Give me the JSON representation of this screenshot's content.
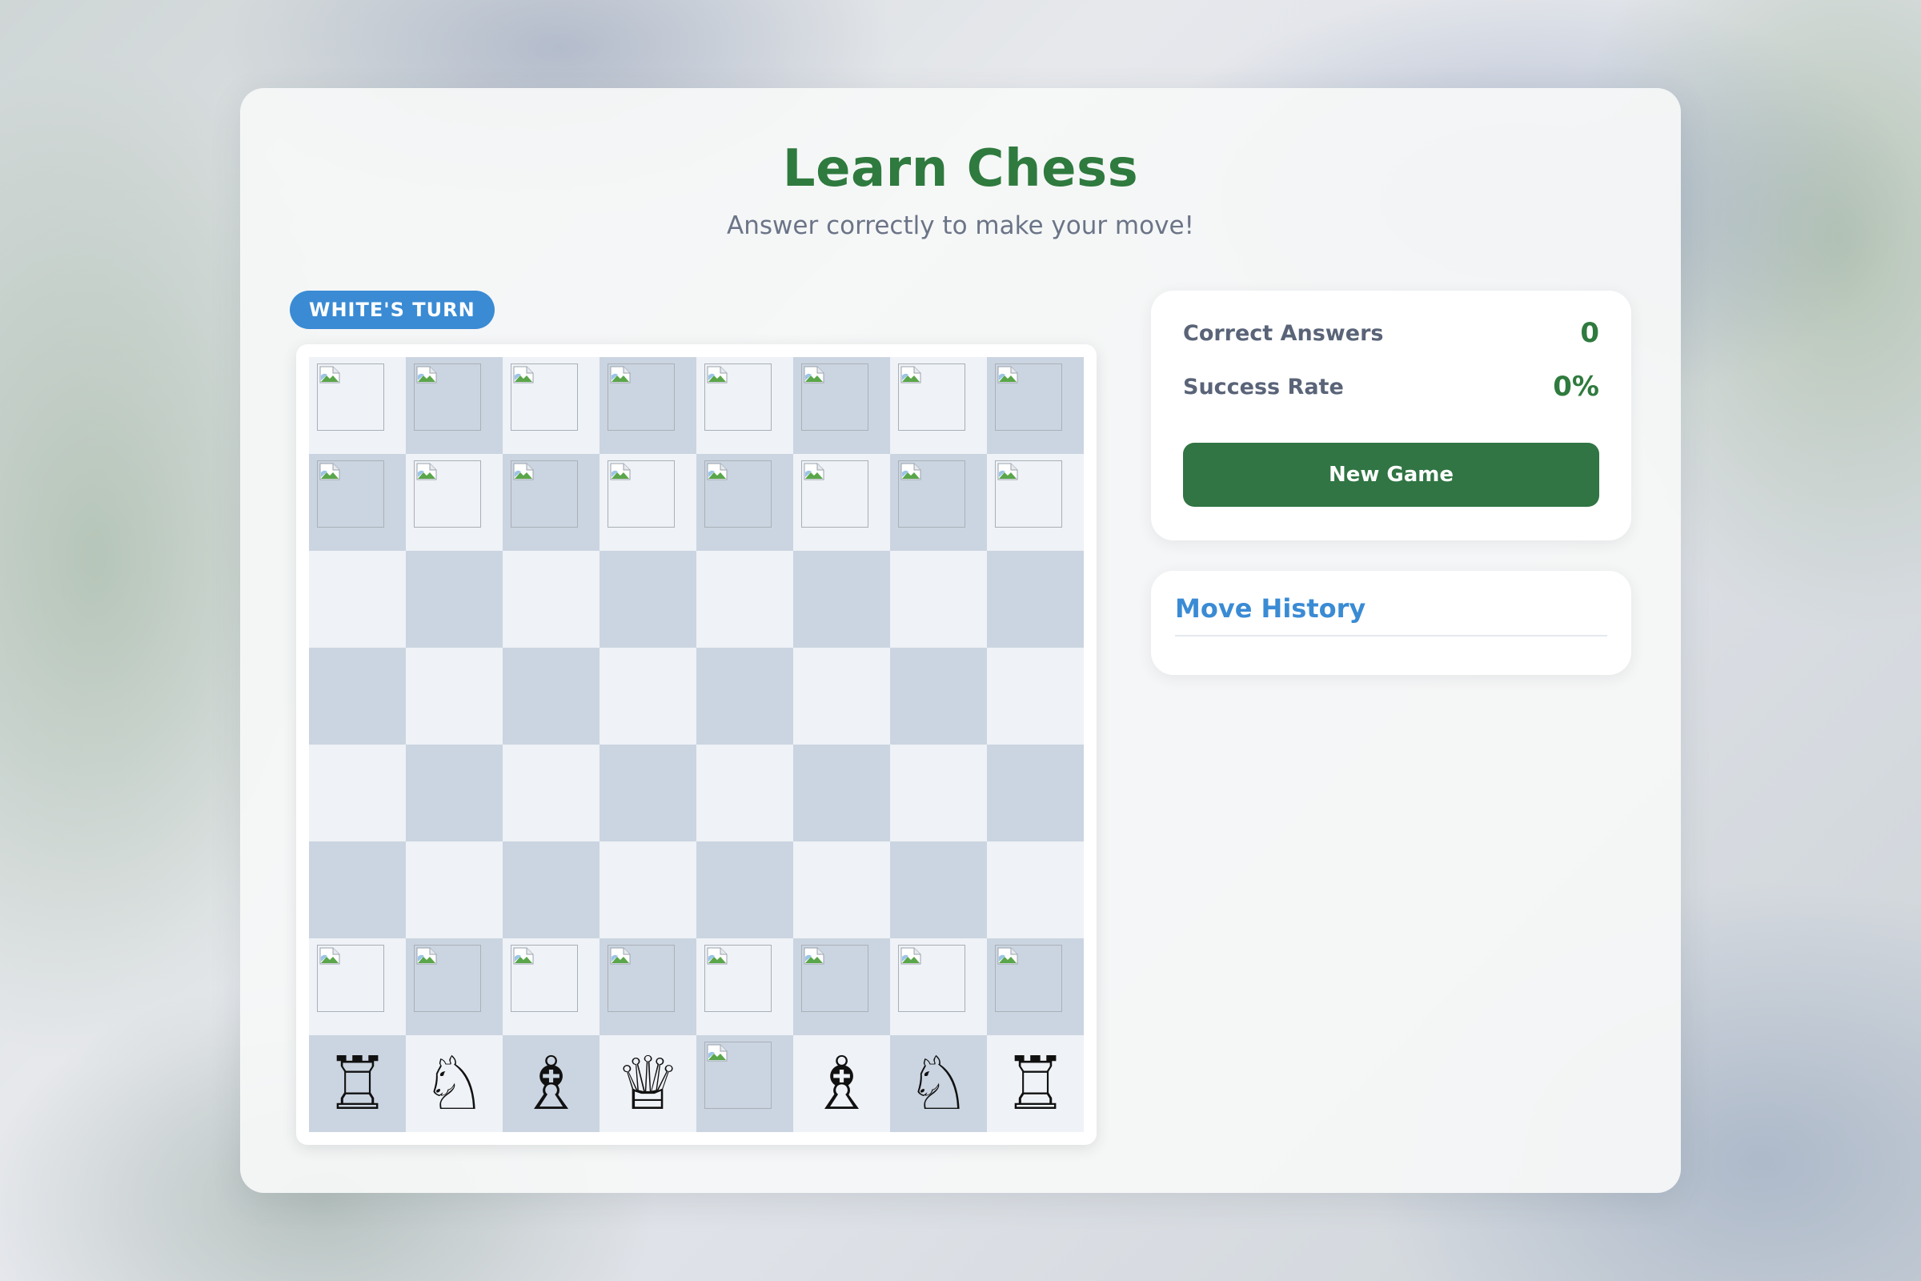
{
  "header": {
    "title": "Learn Chess",
    "subtitle": "Answer correctly to make your move!"
  },
  "status": {
    "turn_label": "WHITE'S TURN"
  },
  "board": {
    "light_color": "#eff2f6",
    "dark_color": "#cbd5e1",
    "ranks": [
      [
        "img",
        "img",
        "img",
        "img",
        "img",
        "img",
        "img",
        "img"
      ],
      [
        "img",
        "img",
        "img",
        "img",
        "img",
        "img",
        "img",
        "img"
      ],
      [
        "",
        "",
        "",
        "",
        "",
        "",
        "",
        ""
      ],
      [
        "",
        "",
        "",
        "",
        "",
        "",
        "",
        ""
      ],
      [
        "",
        "",
        "",
        "",
        "",
        "",
        "",
        ""
      ],
      [
        "",
        "",
        "",
        "",
        "",
        "",
        "",
        ""
      ],
      [
        "img",
        "img",
        "img",
        "img",
        "img",
        "img",
        "img",
        "img"
      ],
      [
        "♖",
        "♘",
        "♗",
        "♕",
        "img",
        "♗",
        "♘",
        "♖"
      ]
    ],
    "piece_names": {
      "♖": "white-rook-icon",
      "♘": "white-knight-icon",
      "♗": "white-bishop-icon",
      "♕": "white-queen-icon",
      "img": "broken-image-icon"
    }
  },
  "stats": {
    "correct_label": "Correct Answers",
    "correct_value": "0",
    "rate_label": "Success Rate",
    "rate_value": "0%",
    "new_game_label": "New Game"
  },
  "history": {
    "title": "Move History"
  },
  "colors": {
    "accent_green": "#2f7a3e",
    "button_green": "#307543",
    "accent_blue": "#3a8bd4"
  }
}
